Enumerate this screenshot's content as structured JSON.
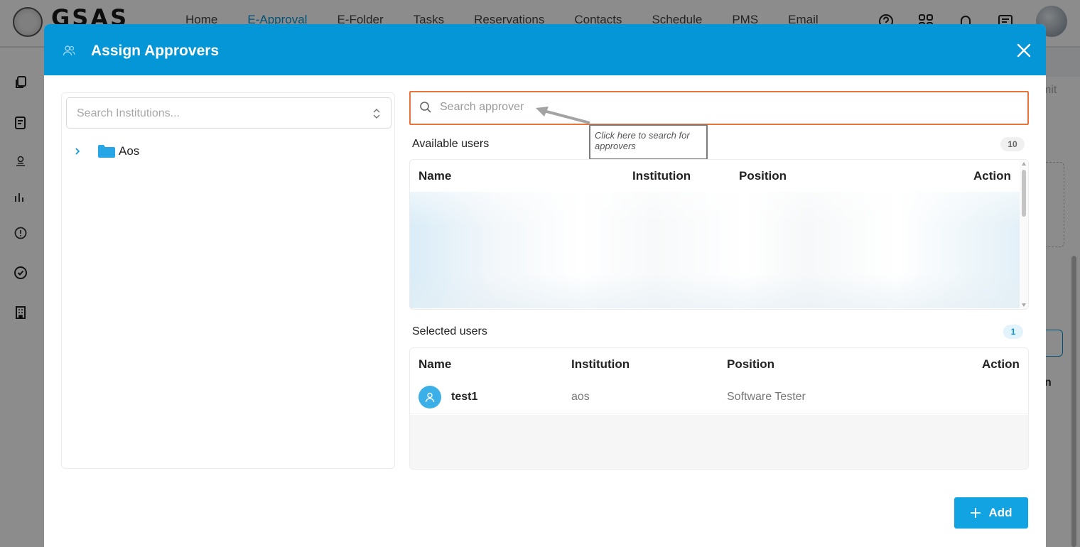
{
  "app": {
    "logo_text": "GSAS",
    "nav": [
      {
        "label": "Home"
      },
      {
        "label": "E-Approval"
      },
      {
        "label": "E-Folder"
      },
      {
        "label": "Tasks"
      },
      {
        "label": "Reservations"
      },
      {
        "label": "Contacts"
      },
      {
        "label": "Schedule"
      },
      {
        "label": "PMS"
      },
      {
        "label": "Email"
      }
    ],
    "active_nav": "E-Approval",
    "header_icons": [
      "help-icon",
      "apps-grid-icon",
      "bell-icon",
      "message-icon"
    ],
    "sidebar_icons": [
      "copy-icon",
      "clipboard-icon",
      "stamp-icon",
      "chart-icon",
      "alert-circle-icon",
      "check-circle-icon",
      "building-icon"
    ],
    "bg_submit_fragment": "mit",
    "bg_bold_fragment": "n"
  },
  "modal": {
    "title": "Assign Approvers",
    "title_icon": "users-icon",
    "close_icon": "close-icon",
    "institution_search_placeholder": "Search Institutions...",
    "tree": [
      {
        "label": "Aos",
        "icon": "folder-icon"
      }
    ],
    "approver_search_placeholder": "Search approver",
    "annotation": "Click here to search for approvers",
    "available": {
      "title": "Available users",
      "count": "10",
      "columns": [
        "Name",
        "Institution",
        "Position",
        "Action"
      ]
    },
    "selected": {
      "title": "Selected users",
      "count": "1",
      "columns": [
        "Name",
        "Institution",
        "Position",
        "Action"
      ],
      "rows": [
        {
          "name": "test1",
          "institution": "aos",
          "position": "Software Tester"
        }
      ]
    },
    "add_button": {
      "icon": "plus-icon",
      "label": "Add"
    }
  },
  "colors": {
    "primary": "#0496d6",
    "highlight_border": "#e8733d",
    "add_button": "#12a3e3"
  }
}
